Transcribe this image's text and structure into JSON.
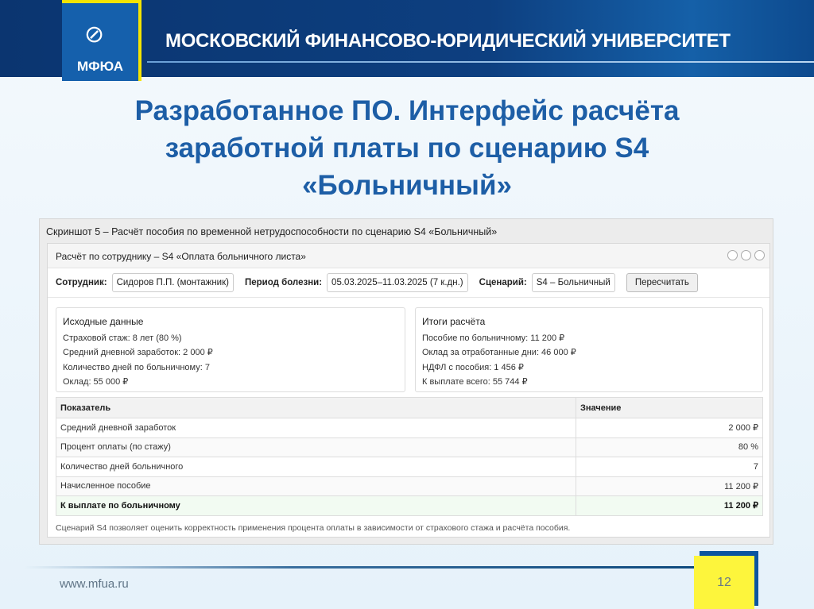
{
  "header": {
    "logo_text": "МФЮА",
    "university": "МОСКОВСКИЙ ФИНАНСОВО-ЮРИДИЧЕСКИЙ УНИВЕРСИТЕТ"
  },
  "slide": {
    "title_lines": [
      "Разработанное ПО. Интерфейс расчёта",
      "заработной платы по сценарию S4",
      "«Больничный»"
    ]
  },
  "screenshot": {
    "caption": "Скриншот 5 – Расчёт пособия по временной нетрудоспособности по сценарию S4 «Больничный»",
    "window_title": "Расчёт по сотруднику – S4 «Оплата больничного листа»",
    "toolbar": {
      "employee_label": "Сотрудник:",
      "employee_value": "Сидоров П.П. (монтажник)",
      "period_label": "Период болезни:",
      "period_value": "05.03.2025–11.03.2025 (7 к.дн.)",
      "scenario_label": "Сценарий:",
      "scenario_value": "S4 – Больничный",
      "recalc_button": "Пересчитать"
    },
    "input_panel": {
      "title": "Исходные данные",
      "lines": [
        "Страховой стаж: 8 лет (80 %)",
        "Средний дневной заработок: 2 000 ₽",
        "Количество дней по больничному: 7",
        "Оклад: 55 000 ₽"
      ]
    },
    "result_panel": {
      "title": "Итоги расчёта",
      "lines": [
        "Пособие по больничному: 11 200 ₽",
        "Оклад за отработанные дни: 46 000 ₽",
        "НДФЛ с пособия: 1 456 ₽",
        "К выплате всего: 55 744 ₽"
      ]
    },
    "table": {
      "headers": [
        "Показатель",
        "Значение"
      ],
      "rows": [
        [
          "Средний дневной заработок",
          "2 000 ₽"
        ],
        [
          "Процент оплаты (по стажу)",
          "80 %"
        ],
        [
          "Количество дней больничного",
          "7"
        ],
        [
          "Начисленное пособие",
          "11 200 ₽"
        ],
        [
          "К выплате по больничному",
          "11 200 ₽"
        ]
      ]
    },
    "note": "Сценарий S4 позволяет оценить корректность применения процента оплаты в зависимости от страхового стажа и расчёта пособия."
  },
  "footer": {
    "url": "www.mfua.ru",
    "page_number": "12"
  },
  "colors": {
    "header_bg": "#0d3f80",
    "title": "#1d5ea6",
    "accent_yellow": "#fdf53c"
  }
}
